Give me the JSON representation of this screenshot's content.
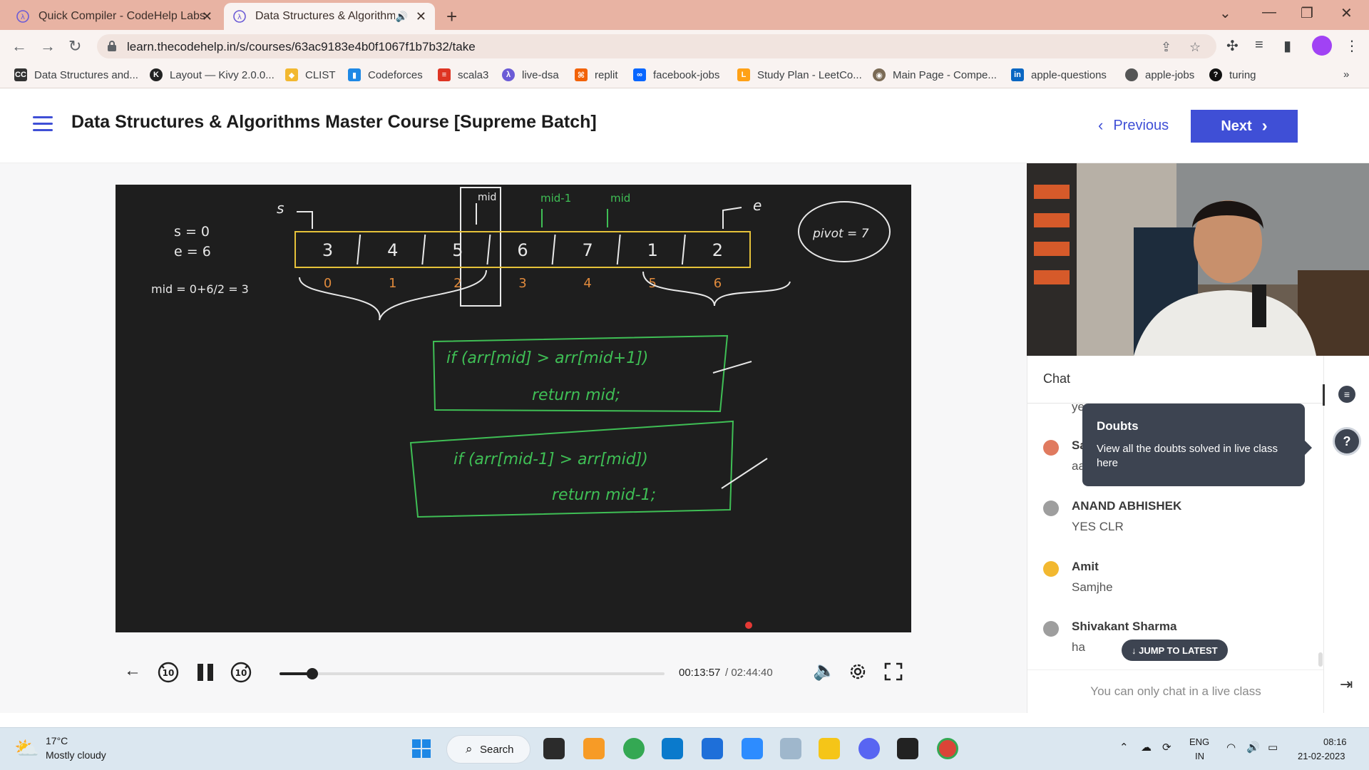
{
  "browser": {
    "tabs": [
      {
        "title": "Quick Compiler - CodeHelp Labs",
        "active": false
      },
      {
        "title": "Data Structures & Algorithm",
        "active": true
      }
    ],
    "url": "learn.thecodehelp.in/s/courses/63ac9183e4b0f1067f1b7b32/take",
    "bookmarks": [
      "Data Structures and...",
      "Layout — Kivy 2.0.0...",
      "CLIST",
      "Codeforces",
      "scala3",
      "live-dsa",
      "replit",
      "facebook-jobs",
      "Study Plan - LeetCo...",
      "Main Page - Compe...",
      "apple-questions",
      "apple-jobs",
      "turing"
    ]
  },
  "header": {
    "course_title": "Data Structures & Algorithms Master Course [Supreme Batch]",
    "previous_label": "Previous",
    "next_label": "Next"
  },
  "whiteboard": {
    "vars": [
      "s = 0",
      "e = 6",
      "mid = 0+6/2 = 3"
    ],
    "array": [
      "3",
      "4",
      "5",
      "6",
      "7",
      "1",
      "2"
    ],
    "indices": [
      "0",
      "1",
      "2",
      "3",
      "4",
      "5",
      "6"
    ],
    "labels": {
      "s": "s",
      "e": "e",
      "mid": "mid",
      "mid_minus": "mid-1",
      "mid2": "mid"
    },
    "pivot_note": "pivot = 7",
    "code1_line1": "if (arr[mid] > arr[mid+1])",
    "code1_line2": "return mid;",
    "code2_line1": "if (arr[mid-1] > arr[mid])",
    "code2_line2": "return mid-1;"
  },
  "player": {
    "current_time": "00:13:57",
    "total_time": "/ 02:44:40",
    "progress": 0.085,
    "skip_back": "10",
    "skip_forward": "10"
  },
  "chat": {
    "title": "Chat",
    "partial_top": "yes",
    "messages": [
      {
        "name": "Sa",
        "text": "aa",
        "avatar_color": "#e07a5f"
      },
      {
        "name": "ANAND ABHISHEK",
        "text": "YES CLR",
        "avatar_color": "#9e9e9e"
      },
      {
        "name": "Amit",
        "text": "Samjhe",
        "avatar_color": "#f2b830"
      },
      {
        "name": "Shivakant Sharma",
        "text": "ha",
        "avatar_color": "#9e9e9e"
      }
    ],
    "jump_label": "↓ JUMP TO LATEST",
    "footer": "You can only chat in a live class"
  },
  "tooltip": {
    "title": "Doubts",
    "text": "View all the doubts solved in live class here"
  },
  "taskbar": {
    "temp": "17°C",
    "weather": "Mostly cloudy",
    "search_label": "Search",
    "lang1": "ENG",
    "lang2": "IN",
    "time": "08:16",
    "date": "21-02-2023"
  },
  "colors": {
    "accent": "#3f4fd6",
    "tabstrip": "#e8b3a3",
    "board": "#1e1e1e",
    "chalk_green": "#3fbf55",
    "array_yellow": "#e6c23a",
    "index_orange": "#e08a3c",
    "tooltip": "#3d4451"
  }
}
